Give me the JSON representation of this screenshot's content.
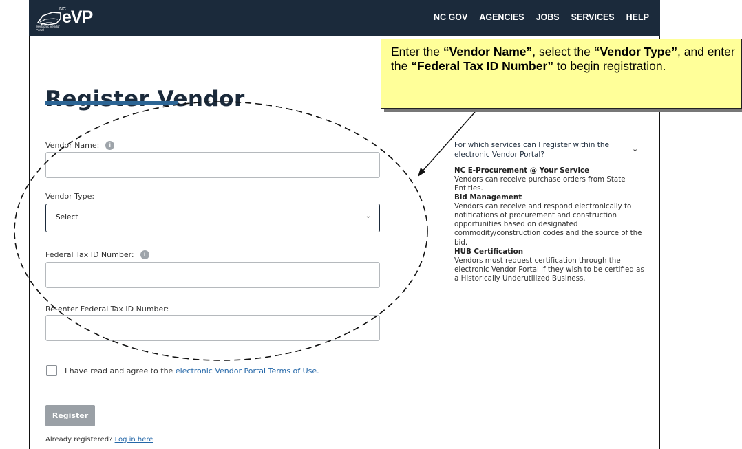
{
  "header": {
    "logo_small_text": "NC",
    "logo_sub_text": "electronic Vendor Portal",
    "logo_mark": "eVP",
    "nav": [
      "NC GOV",
      "AGENCIES",
      "JOBS",
      "SERVICES",
      "HELP"
    ]
  },
  "page": {
    "title": "Register Vendor"
  },
  "form": {
    "vendor_name_label": "Vendor Name:",
    "vendor_type_label": "Vendor Type:",
    "vendor_type_value": "Select",
    "tax_id_label": "Federal Tax ID Number:",
    "reenter_tax_id_label": "Re-enter Federal Tax ID Number:",
    "agree_text": "I have read and agree to the ",
    "agree_link": "electronic Vendor Portal Terms of Use.",
    "register_label": "Register",
    "already_text": "Already registered? ",
    "login_link": "Log in here"
  },
  "faq": {
    "question": "For which services can I register within the electronic Vendor Portal?",
    "items": [
      {
        "heading": "NC E-Procurement @ Your Service",
        "text": "Vendors can receive purchase orders from State Entities."
      },
      {
        "heading": "Bid Management",
        "text": "Vendors can receive and respond electronically to notifications of procurement and construction opportunities based on designated commodity/construction codes and the source of the bid."
      },
      {
        "heading": "HUB Certification",
        "text": "Vendors must request certification through the electronic Vendor Portal if they wish to be certified as a Historically Underutilized Business."
      }
    ]
  },
  "callout": {
    "t1": "Enter the ",
    "b1": "“Vendor Name”",
    "t2": ", select the ",
    "b2": "“Vendor Type”",
    "t3": ", and enter the ",
    "b3": "“Federal Tax ID Number”",
    "t4": " to begin registration."
  },
  "colors": {
    "topbar": "#1b2a3b",
    "accent_bar": "#2c6595",
    "link": "#2467a8",
    "callout_bg": "#ffff99",
    "button_disabled": "#9aa0a6"
  }
}
